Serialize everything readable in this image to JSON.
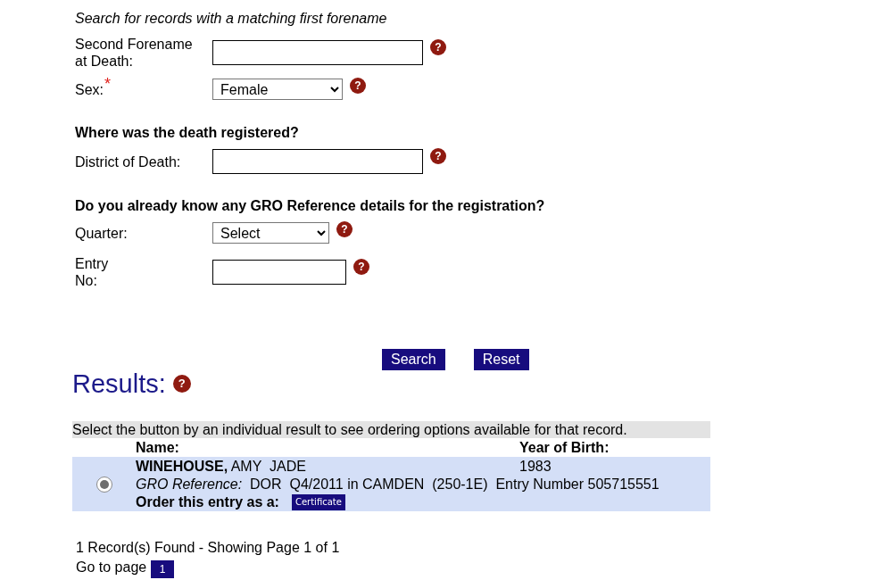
{
  "search_form": {
    "sections": [
      {
        "hint": "Search for records with a matching first forename",
        "fields": [
          {
            "kind": "text",
            "label": "Second Forename\nat Death:",
            "help": "?"
          },
          {
            "kind": "select",
            "label": "Sex:",
            "required_mark": "*",
            "value": "Female",
            "help": "?"
          }
        ]
      },
      {
        "heading": "Where was the death registered?",
        "fields": [
          {
            "kind": "text",
            "label": "District of Death:",
            "help": "?"
          }
        ]
      },
      {
        "heading": "Do you already know any GRO Reference details for the registration?",
        "fields": [
          {
            "kind": "select",
            "label": "Quarter:",
            "value": "Select",
            "help": "?"
          },
          {
            "kind": "number",
            "label": "Entry\nNo:",
            "help": "?"
          }
        ]
      }
    ],
    "buttons": [
      "Search",
      "Reset"
    ]
  },
  "results": {
    "title": "Results:",
    "help": "?",
    "instruction": "Select the button by an individual result to see ordering options available for that record.",
    "columns": [
      "Name:",
      "Year of Birth:"
    ],
    "rows": [
      {
        "selected": true,
        "name": "**WINEHOUSE,** AMY  JADE",
        "year_of_birth": "1983",
        "reference": "*GRO Reference:*  DOR  Q4/2011 in CAMDEN  (250-1E)  Entry Number 505715551",
        "order_label": "Order this entry as a:",
        "order_button": "Certificate"
      }
    ],
    "summary": "1 Record(s) Found - Showing Page 1 of 1",
    "pagination": {
      "label": "Go to page",
      "pages": [
        "1"
      ]
    }
  }
}
